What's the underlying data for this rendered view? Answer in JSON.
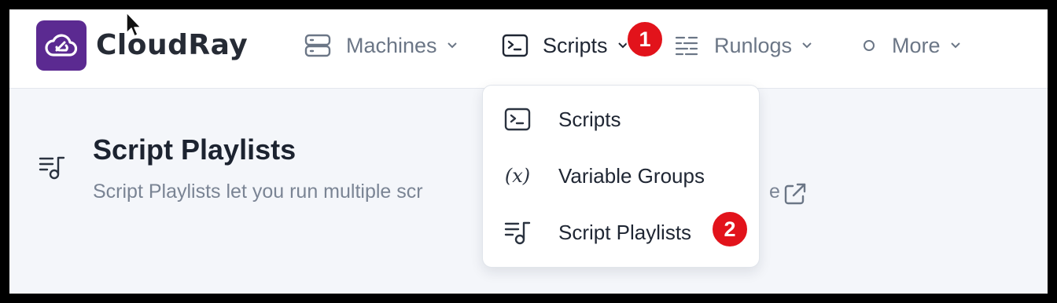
{
  "brand": {
    "name": "CloudRay",
    "logo_icon": "cloud-icon",
    "logo_color": "#5b2a91"
  },
  "nav": {
    "items": [
      {
        "label": "Machines",
        "icon": "server-icon"
      },
      {
        "label": "Scripts",
        "icon": "terminal-icon"
      },
      {
        "label": "Runlogs",
        "icon": "list-lines-icon"
      },
      {
        "label": "More",
        "icon": "circle-icon"
      }
    ]
  },
  "badges": {
    "first": "1",
    "second": "2",
    "color": "#e2131b"
  },
  "dropdown": {
    "items": [
      {
        "label": "Scripts",
        "icon": "terminal-icon"
      },
      {
        "label": "Variable Groups",
        "icon": "variable-icon",
        "glyph": "(x)"
      },
      {
        "label": "Script Playlists",
        "icon": "playlist-icon"
      }
    ]
  },
  "page": {
    "title": "Script Playlists",
    "description": "Script Playlists let you run multiple scr",
    "description_tail": "e",
    "icon": "playlist-icon"
  }
}
